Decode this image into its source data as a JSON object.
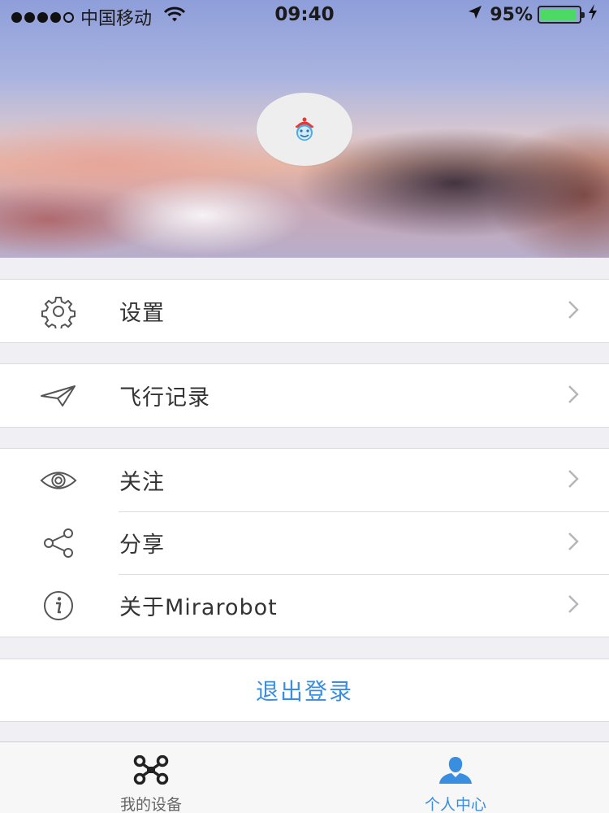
{
  "status_bar": {
    "carrier": "中国移动",
    "time": "09:40",
    "battery_percent": "95%",
    "battery_level": 0.95
  },
  "colors": {
    "accent": "#3a8ee0",
    "battery": "#4cd964",
    "background": "#efeff4"
  },
  "menu": {
    "settings": {
      "label": "设置",
      "icon": "gear-icon"
    },
    "flight_log": {
      "label": "飞行记录",
      "icon": "paper-plane-icon"
    },
    "follow": {
      "label": "关注",
      "icon": "eye-icon"
    },
    "share": {
      "label": "分享",
      "icon": "share-icon"
    },
    "about": {
      "label": "关于Mirarobot",
      "icon": "info-icon"
    }
  },
  "logout": {
    "label": "退出登录"
  },
  "tabbar": {
    "devices": {
      "label": "我的设备",
      "icon": "drone-icon"
    },
    "profile": {
      "label": "个人中心",
      "icon": "person-icon",
      "selected": true
    }
  }
}
